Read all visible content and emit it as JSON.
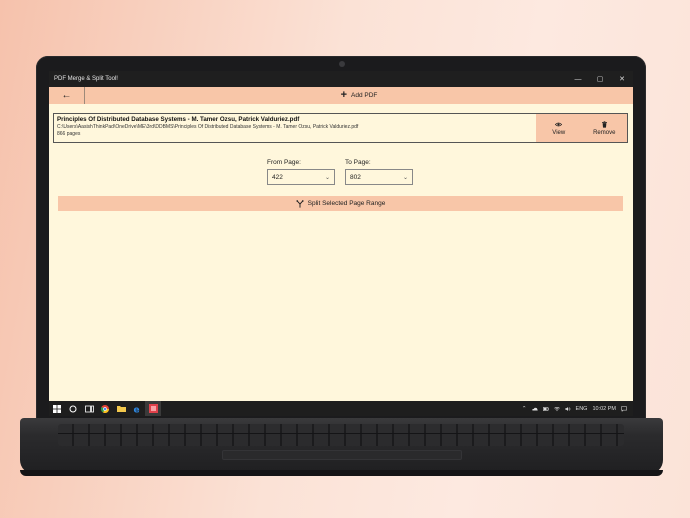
{
  "window": {
    "title": "PDF Merge & Split Tool!",
    "minimize": "—",
    "maximize": "▢",
    "close": "✕"
  },
  "appbar": {
    "back": "←",
    "add_pdf": "Add PDF"
  },
  "file": {
    "name": "Principles Of Distributed Database Systems  -  M. Tamer Ozsu, Patrick Valduriez.pdf",
    "path": "C:\\Users\\AasishThinkPad\\OneDrive\\ME\\3rd\\DDBMS\\Principles Of Distributed Database Systems  -  M. Tamer Ozsu, Patrick Valduriez.pdf",
    "pages": "866 pages",
    "view_label": "View",
    "remove_label": "Remove"
  },
  "range": {
    "from_label": "From Page:",
    "from_value": "422",
    "to_label": "To Page:",
    "to_value": "802"
  },
  "split_button": "Split Selected Page Range",
  "taskbar": {
    "language": "ENG",
    "time": "10:02 PM"
  },
  "colors": {
    "accent": "#f8c6a8",
    "background": "#fff7dc",
    "titlebar": "#1f1f1f",
    "taskbar": "#1e1e1e"
  }
}
